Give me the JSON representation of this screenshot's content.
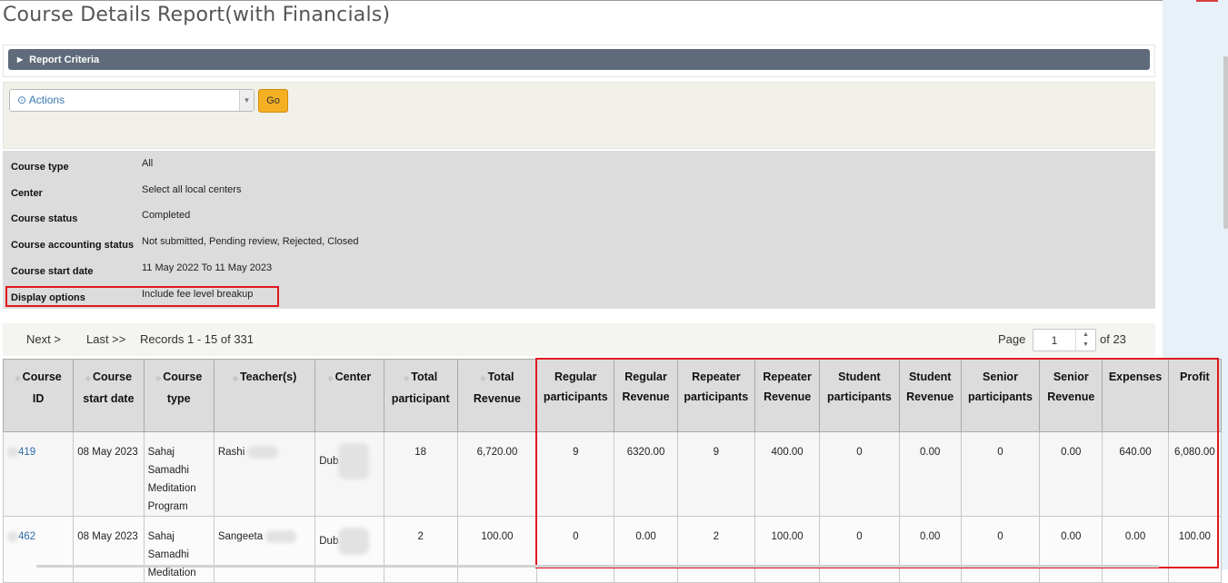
{
  "page": {
    "title": "Course Details Report(with Financials)"
  },
  "criteria": {
    "label": "Report Criteria"
  },
  "actions": {
    "select_label": "Actions",
    "go_label": "Go"
  },
  "summary": [
    {
      "label": "Course type",
      "value": "All"
    },
    {
      "label": "Center",
      "value": "Select all local centers"
    },
    {
      "label": "Course status",
      "value": "Completed"
    },
    {
      "label": "Course accounting status",
      "value": "Not submitted, Pending review, Rejected, Closed"
    },
    {
      "label": "Course start date",
      "value": "11 May 2022 To 11 May 2023"
    },
    {
      "label": "Display options",
      "value": "Include fee level breakup"
    }
  ],
  "pager": {
    "next": "Next >",
    "last": "Last >>",
    "records": "Records 1 - 15 of 331",
    "page_label": "Page",
    "page_value": "1",
    "of_pages": "of 23"
  },
  "table": {
    "columns": [
      {
        "l1": "Course",
        "l2": "ID"
      },
      {
        "l1": "Course",
        "l2": "start date"
      },
      {
        "l1": "Course",
        "l2": "type"
      },
      {
        "l1": "Teacher(s)",
        "l2": ""
      },
      {
        "l1": "Center",
        "l2": ""
      },
      {
        "l1": "Total",
        "l2": "participant"
      },
      {
        "l1": "Total",
        "l2": "Revenue"
      },
      {
        "l1": "Regular",
        "l2": "participants"
      },
      {
        "l1": "Regular",
        "l2": "Revenue"
      },
      {
        "l1": "Repeater",
        "l2": "participants"
      },
      {
        "l1": "Repeater",
        "l2": "Revenue"
      },
      {
        "l1": "Student",
        "l2": "participants"
      },
      {
        "l1": "Student",
        "l2": "Revenue"
      },
      {
        "l1": "Senior",
        "l2": "participants"
      },
      {
        "l1": "Senior",
        "l2": "Revenue"
      },
      {
        "l1": "Expenses",
        "l2": ""
      },
      {
        "l1": "Profit",
        "l2": ""
      }
    ],
    "rows": [
      {
        "id": "419",
        "start": "08 May 2023",
        "type": "Sahaj Samadhi Meditation Program",
        "teacher": "Rashi",
        "center": "Dub",
        "total_part": "18",
        "total_rev": "6,720.00",
        "reg_part": "9",
        "reg_rev": "6320.00",
        "rep_part": "9",
        "rep_rev": "400.00",
        "stu_part": "0",
        "stu_rev": "0.00",
        "sen_part": "0",
        "sen_rev": "0.00",
        "expenses": "640.00",
        "profit": "6,080.00"
      },
      {
        "id": "462",
        "start": "08 May 2023",
        "type": "Sahaj Samadhi Meditation",
        "teacher": "Sangeeta",
        "center": "Dub",
        "total_part": "2",
        "total_rev": "100.00",
        "reg_part": "0",
        "reg_rev": "0.00",
        "rep_part": "2",
        "rep_rev": "100.00",
        "stu_part": "0",
        "stu_rev": "0.00",
        "sen_part": "0",
        "sen_rev": "0.00",
        "expenses": "0.00",
        "profit": "100.00"
      }
    ]
  }
}
